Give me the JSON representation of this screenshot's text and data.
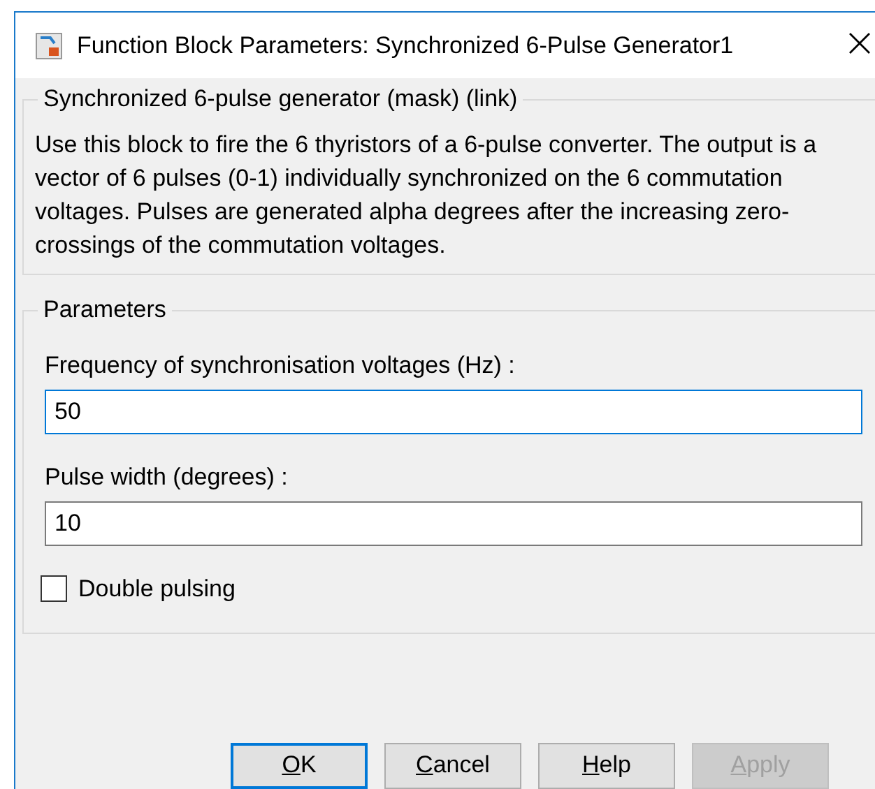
{
  "window": {
    "title": "Function Block Parameters: Synchronized 6-Pulse Generator1"
  },
  "description": {
    "title": "Synchronized 6-pulse generator (mask) (link)",
    "text": "Use this block to fire the 6 thyristors of a 6-pulse converter. The output is a vector of 6 pulses (0-1) individually synchronized on the 6 commutation voltages. Pulses are generated alpha degrees after the increasing zero-crossings of the commutation voltages."
  },
  "parameters": {
    "title": "Parameters",
    "fields": [
      {
        "label": "Frequency of synchronisation voltages (Hz) :",
        "value": "50",
        "focused": true
      },
      {
        "label": "Pulse width (degrees) :",
        "value": "10",
        "focused": false
      }
    ],
    "checkbox": {
      "label": "Double pulsing",
      "checked": false
    }
  },
  "buttons": [
    {
      "label": "OK",
      "default": true,
      "disabled": false
    },
    {
      "label": "Cancel",
      "default": false,
      "disabled": false
    },
    {
      "label": "Help",
      "default": false,
      "disabled": false
    },
    {
      "label": "Apply",
      "default": false,
      "disabled": true
    }
  ]
}
